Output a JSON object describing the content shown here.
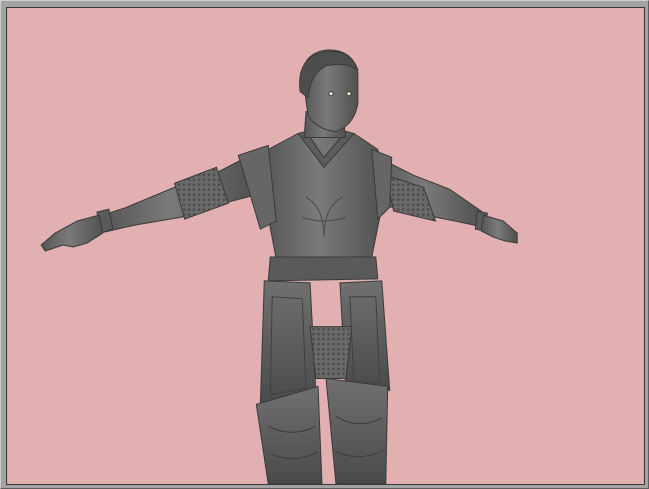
{
  "viewport": {
    "background_color": "#e2b0b0",
    "model_color": "#6c6c6c",
    "model_highlight": "#8a8a8a",
    "model_shadow": "#3f3f3f",
    "eye_color": "#d8f0c8"
  },
  "frame": {
    "bevel_light": "#cfcfcf",
    "bevel_dark": "#5f5f5f"
  }
}
